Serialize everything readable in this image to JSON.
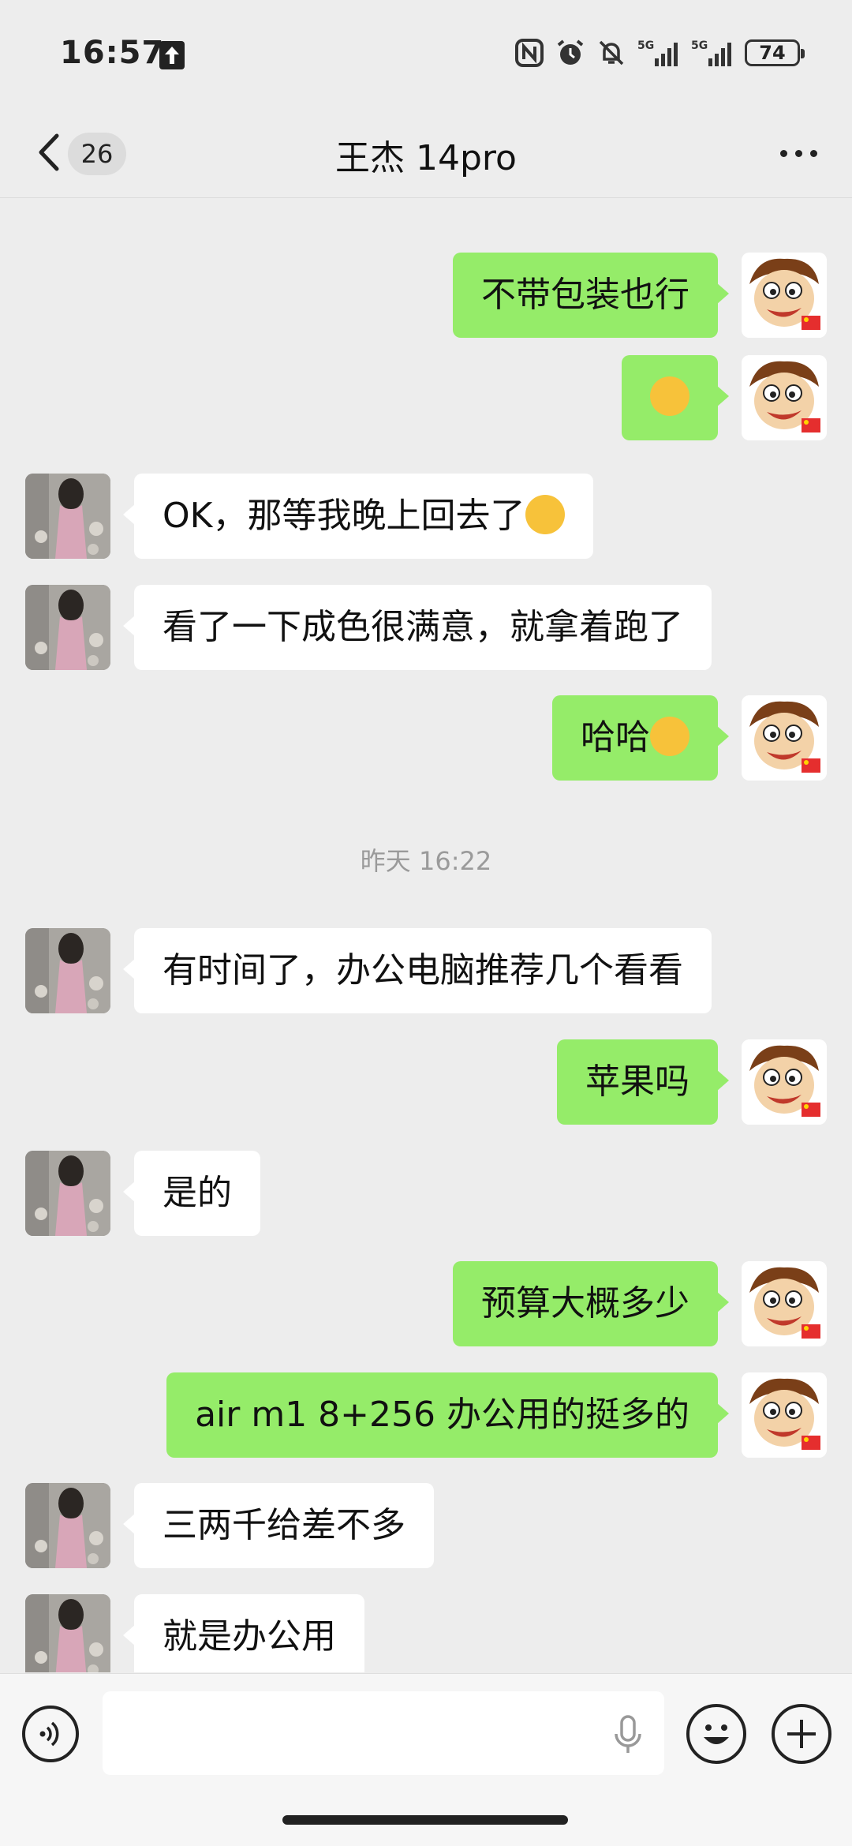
{
  "status_bar": {
    "time": "16:57",
    "battery": "74",
    "icons": [
      "nfc-icon",
      "alarm-icon",
      "mute-icon",
      "5g-signal-icon",
      "5g-signal-icon"
    ]
  },
  "nav": {
    "unread_count": "26",
    "title": "王杰 14pro"
  },
  "messages": [
    {
      "side": "me",
      "text": "不带包装也行"
    },
    {
      "side": "me",
      "text": "",
      "emoji": "thinking-face"
    },
    {
      "side": "her",
      "text": "OK，那等我晚上回去了",
      "emoji": "laughing-tears"
    },
    {
      "side": "her",
      "text": "看了一下成色很满意，就拿着跑了"
    },
    {
      "side": "me",
      "text": "哈哈",
      "emoji": "grinning-face"
    },
    {
      "side": "her",
      "text": "有时间了，办公电脑推荐几个看看"
    },
    {
      "side": "me",
      "text": "苹果吗"
    },
    {
      "side": "her",
      "text": "是的"
    },
    {
      "side": "me",
      "text": "预算大概多少"
    },
    {
      "side": "me",
      "text": "air m1 8+256 办公用的挺多的"
    },
    {
      "side": "her",
      "text": "三两千给差不多"
    },
    {
      "side": "her",
      "text": "就是办公用"
    }
  ],
  "timestamp": "昨天 16:22",
  "input": {
    "value": "",
    "placeholder": ""
  },
  "colors": {
    "background": "#ededed",
    "my_bubble": "#95ec69",
    "their_bubble": "#ffffff"
  }
}
